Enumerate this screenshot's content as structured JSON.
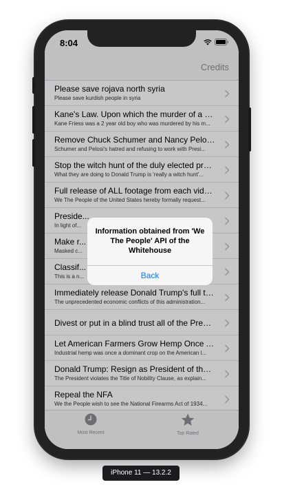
{
  "status_bar": {
    "time": "8:04"
  },
  "nav": {
    "credits_label": "Credits"
  },
  "petitions": [
    {
      "title": "Please save rojava north syria",
      "subtitle": "Please save kurdish people in syria"
    },
    {
      "title": "Kane's Law. Upon which the murder of a child...",
      "subtitle": "Kane Friess was a 2 year old boy who was murdered by his m..."
    },
    {
      "title": "Remove Chuck Schumer and Nancy Pelosi fr...",
      "subtitle": "Schumer and Pelosi's hatred and refusing to work with Presi..."
    },
    {
      "title": "Stop the witch hunt of the duly elected presi...",
      "subtitle": "What they are doing to Donald Trump is 'really a witch hunt'..."
    },
    {
      "title": "Full release of ALL footage from each video...",
      "subtitle": "We The People of the United States hereby formally request..."
    },
    {
      "title": "Preside...",
      "subtitle": "In light of..."
    },
    {
      "title": "Make r...",
      "subtitle": "Masked c..."
    },
    {
      "title": "Classif...",
      "subtitle": "This is a n..."
    },
    {
      "title": "Immediately release Donald Trump's full tax...",
      "subtitle": "The unprecedented economic conflicts of this administration..."
    },
    {
      "title": "Divest or put in a blind trust all of the Presid...",
      "subtitle": ""
    },
    {
      "title": "Let American Farmers Grow Hemp Once Aga...",
      "subtitle": "Industrial hemp was once a dominant crop on the American l..."
    },
    {
      "title": "Donald Trump:  Resign as President of the U...",
      "subtitle": "The President violates the Title of Nobility Clause, as explain..."
    },
    {
      "title": "Repeal the NFA",
      "subtitle": "We the People wish to see the National Firearms Act of 1934..."
    }
  ],
  "alert": {
    "message": "Information obtained from 'We The People' API of the Whitehouse",
    "button_label": "Back"
  },
  "tabs": [
    {
      "label": "Most Recent",
      "icon": "clock-icon"
    },
    {
      "label": "Top Rated",
      "icon": "star-icon"
    }
  ],
  "device_caption": "iPhone 11 — 13.2.2",
  "colors": {
    "accent": "#0a7aff",
    "secondary_text": "#8e8e93",
    "device_frame": "#222222"
  }
}
